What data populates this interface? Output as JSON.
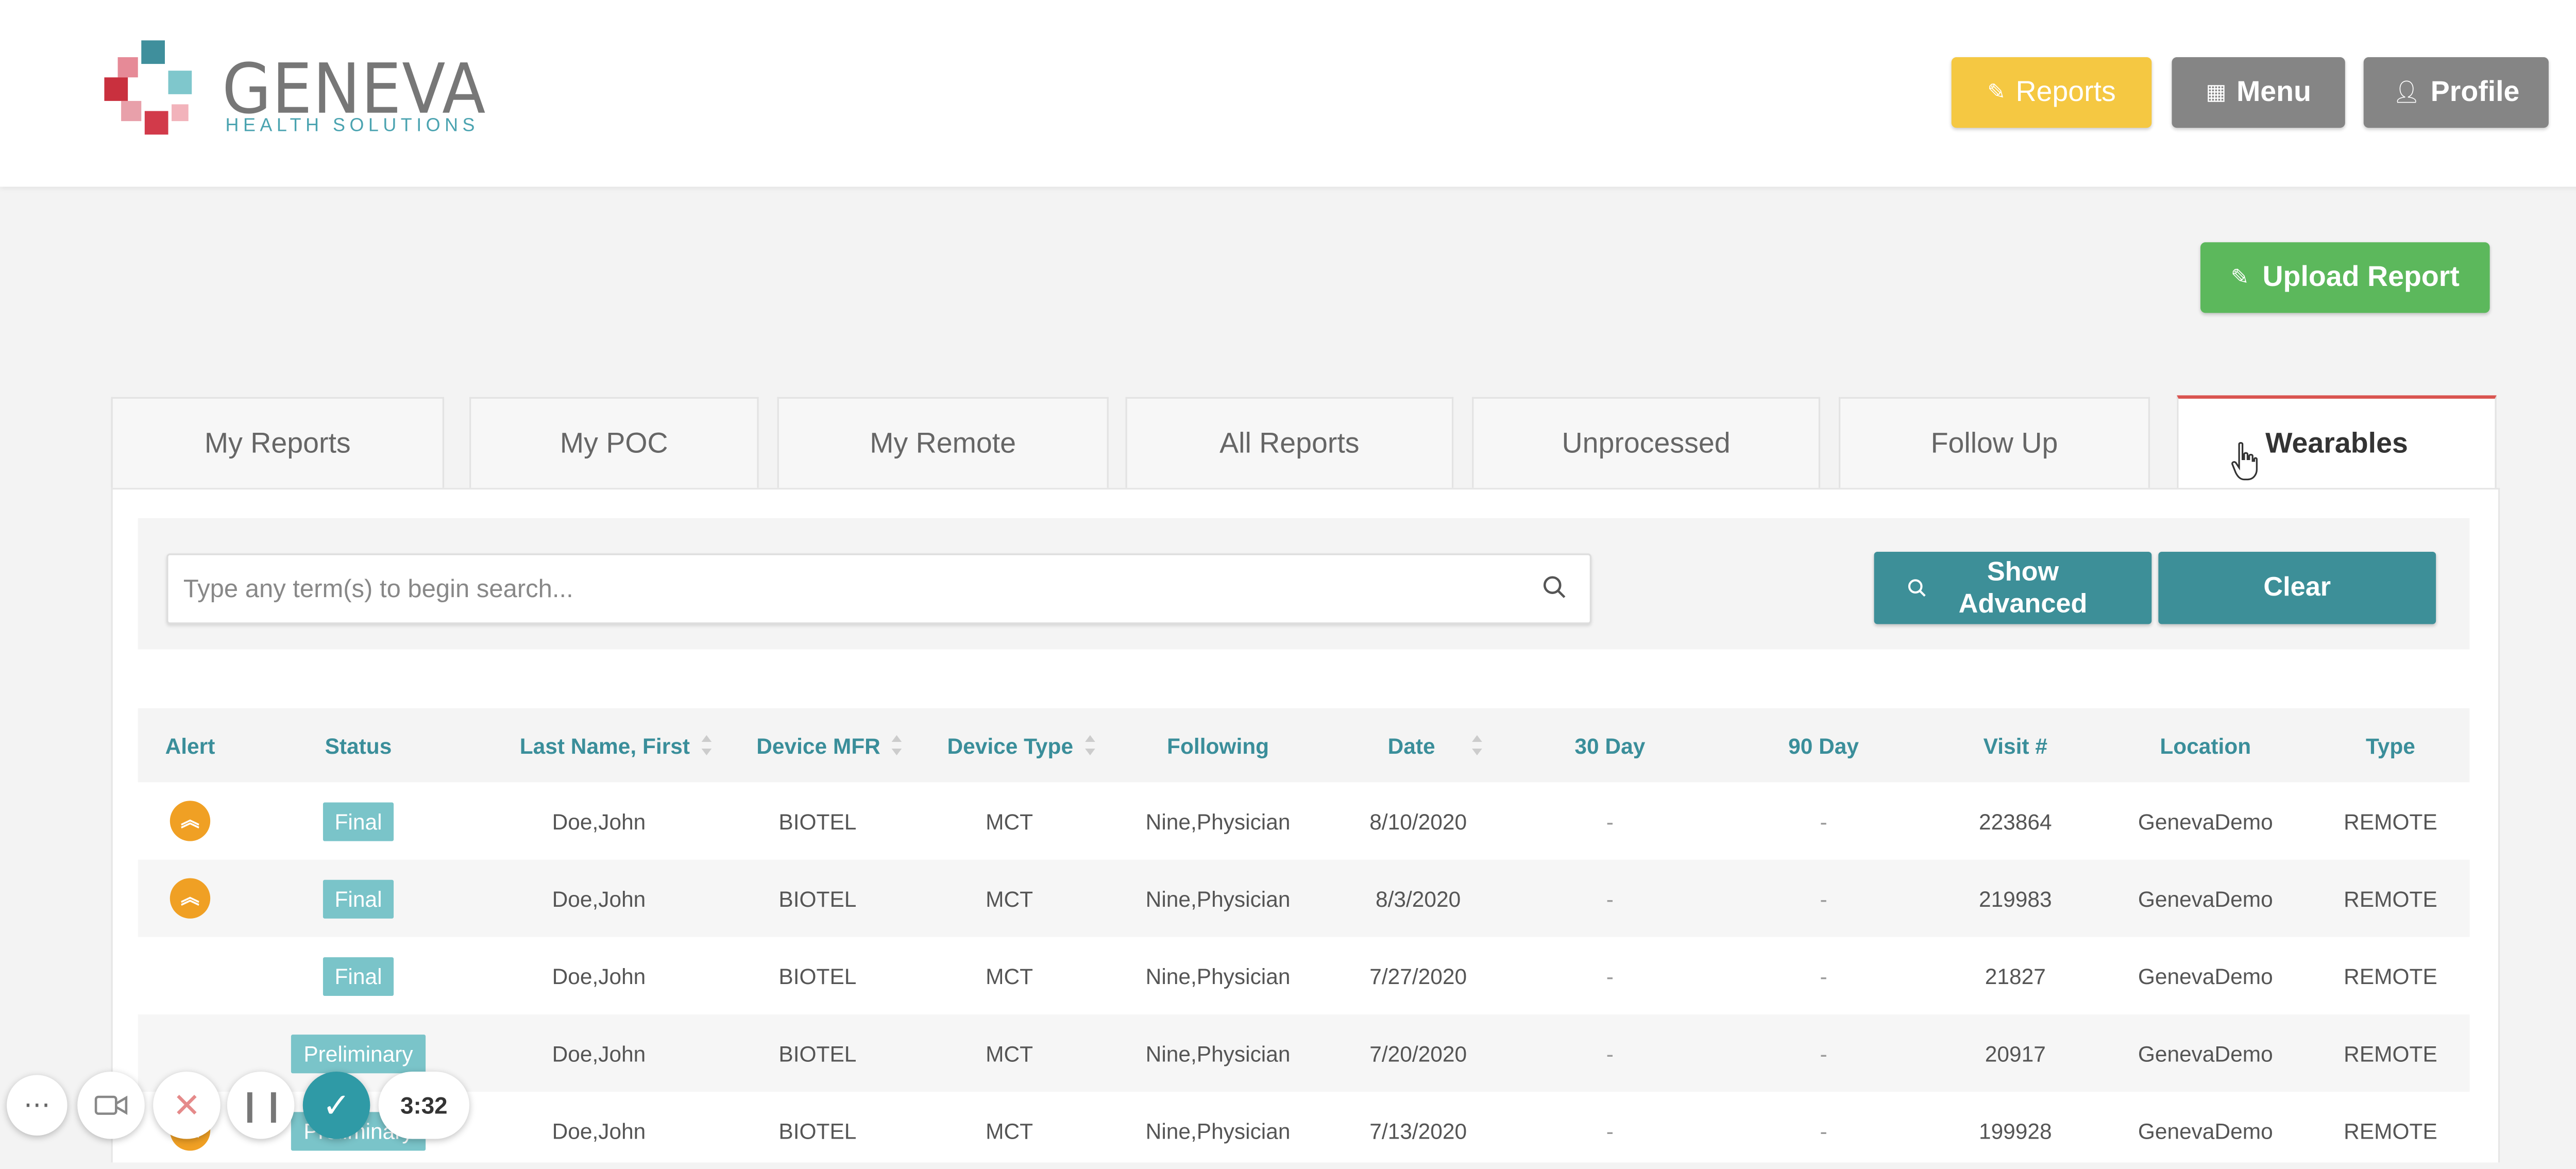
{
  "logo": {
    "word": "GENEVA",
    "sub": "HEALTH SOLUTIONS"
  },
  "header": {
    "reports_label": "Reports",
    "menu_label": "Menu",
    "profile_label": "Profile"
  },
  "upload_label": "Upload Report",
  "tabs": [
    {
      "label": "My Reports"
    },
    {
      "label": "My POC"
    },
    {
      "label": "My Remote"
    },
    {
      "label": "All Reports"
    },
    {
      "label": "Unprocessed"
    },
    {
      "label": "Follow Up"
    },
    {
      "label": "Wearables"
    }
  ],
  "search": {
    "placeholder": "Type any term(s) to begin search...",
    "show_advanced_line1": "Show",
    "show_advanced_line2": "Advanced",
    "clear_label": "Clear"
  },
  "table": {
    "columns": [
      "Alert",
      "Status",
      "Last Name, First",
      "Device MFR",
      "Device Type",
      "Following",
      "Date",
      "30 Day",
      "90 Day",
      "Visit #",
      "Location",
      "Type"
    ],
    "rows": [
      {
        "alert": true,
        "status": "Final",
        "name": "Doe,John",
        "mfr": "BIOTEL",
        "type": "MCT",
        "following": "Nine,Physician",
        "date": "8/10/2020",
        "d30": "-",
        "d90": "-",
        "visit": "223864",
        "location": "GenevaDemo",
        "kind": "REMOTE"
      },
      {
        "alert": true,
        "status": "Final",
        "name": "Doe,John",
        "mfr": "BIOTEL",
        "type": "MCT",
        "following": "Nine,Physician",
        "date": "8/3/2020",
        "d30": "-",
        "d90": "-",
        "visit": "219983",
        "location": "GenevaDemo",
        "kind": "REMOTE"
      },
      {
        "alert": false,
        "status": "Final",
        "name": "Doe,John",
        "mfr": "BIOTEL",
        "type": "MCT",
        "following": "Nine,Physician",
        "date": "7/27/2020",
        "d30": "-",
        "d90": "-",
        "visit": "21827",
        "location": "GenevaDemo",
        "kind": "REMOTE"
      },
      {
        "alert": false,
        "status": "Preliminary",
        "name": "Doe,John",
        "mfr": "BIOTEL",
        "type": "MCT",
        "following": "Nine,Physician",
        "date": "7/20/2020",
        "d30": "-",
        "d90": "-",
        "visit": "20917",
        "location": "GenevaDemo",
        "kind": "REMOTE"
      },
      {
        "alert": true,
        "status": "Preliminary",
        "name": "Doe,John",
        "mfr": "BIOTEL",
        "type": "MCT",
        "following": "Nine,Physician",
        "date": "7/13/2020",
        "d30": "-",
        "d90": "-",
        "visit": "199928",
        "location": "GenevaDemo",
        "kind": "REMOTE"
      }
    ]
  },
  "recorder": {
    "timer": "3:32"
  },
  "colors": {
    "reports_btn": "#f5c842",
    "menu_btn": "#858585",
    "upload_btn": "#5cb85c",
    "teal_btn": "#3d8f98",
    "header_text": "#3a8e9a",
    "alert": "#f0a024",
    "active_tab_border": "#d9534f"
  }
}
